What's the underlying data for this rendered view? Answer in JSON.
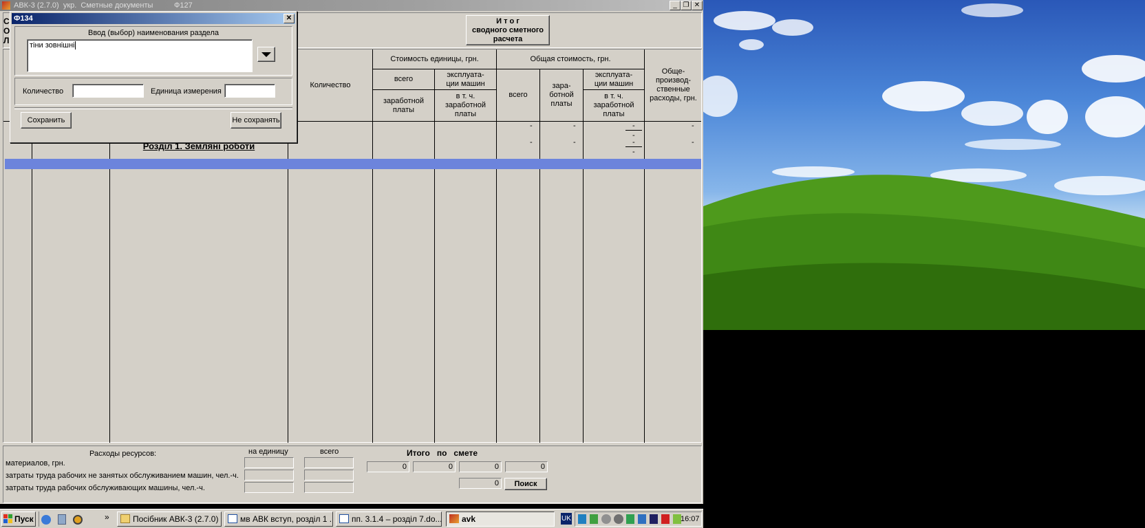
{
  "app": {
    "title": "АВК-3 (2.7.0)  укр.  Сметные документы          Ф127",
    "left_letters": [
      "С",
      "О",
      "Л"
    ],
    "summary_button": "И т о г\nсводного сметного\nрасчета"
  },
  "table": {
    "headers": {
      "quantity": "Количество",
      "unit_cost": "Стоимость единицы, грн.",
      "unit_total": "всего",
      "unit_machines": "эксплуата-\nции машин",
      "unit_wages": "заработной\nплаты",
      "unit_incl_wages": "в т. ч.\nзаработной\nплаты",
      "total_cost": "Общая стоимость, грн.",
      "total_all": "всего",
      "total_wages": "зара-\nботной\nплаты",
      "total_machines": "эксплуата-\nции машин",
      "total_incl_wages": "в т. ч.\nзаработной\nплаты",
      "overhead": "Обще-\nпроизвод-\nственные\nрасходы, грн."
    },
    "section_title": "Розділ 1. Земляні роботи",
    "dash": "-"
  },
  "dialog": {
    "title": "Ф134",
    "section_label": "Ввод (выбор) наименования раздела",
    "section_value": "тіни зовнішні",
    "quantity_label": "Количество",
    "quantity_value": "",
    "unit_label": "Единица измерения",
    "unit_value": "",
    "save": "Сохранить",
    "dont_save": "Не сохранять"
  },
  "resources": {
    "title": "Расходы ресурсов:",
    "per_unit": "на единицу",
    "total": "всего",
    "rows": [
      "материалов, грн.",
      "затраты труда рабочих не занятых обслуживанием машин, чел.-ч.",
      "затраты труда рабочих обслуживающих машины, чел.-ч."
    ],
    "itogo_label": "Итого   по   смете",
    "totals": [
      "0",
      "0",
      "0",
      "0"
    ],
    "total_extra": "0",
    "search_button": "Поиск"
  },
  "taskbar": {
    "start": "Пуск",
    "chevron": "»",
    "tasks": [
      "Посібник АВК-3 (2.7.0)",
      "мв АВК вступ, розділ 1 ...",
      "пп. 3.1.4 – розділ 7.do...",
      "avk"
    ],
    "lang": "UK",
    "clock": "16:07"
  }
}
